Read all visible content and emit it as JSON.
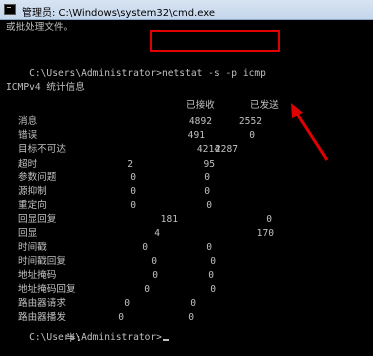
{
  "window": {
    "title": "管理员: C:\\Windows\\system32\\cmd.exe"
  },
  "console": {
    "line_top_partial": "或批处理文件。",
    "prompt_1": "C:\\Users\\Administrator>",
    "command": "netstat -s -p icmp",
    "section_title": "ICMPv4 统计信息",
    "header_received": "已接收",
    "header_sent": "已发送",
    "rows": [
      {
        "label": "消息",
        "received": "4892",
        "sent": "2552"
      },
      {
        "label": "错误",
        "received": "491",
        "sent": "0"
      },
      {
        "label": "目标不可达",
        "received": "4214",
        "sent": "2287"
      },
      {
        "label": "超时",
        "received": "2",
        "sent": "95"
      },
      {
        "label": "参数问题",
        "received": "0",
        "sent": "0"
      },
      {
        "label": "源抑制",
        "received": "0",
        "sent": "0"
      },
      {
        "label": "重定向",
        "received": "0",
        "sent": "0"
      },
      {
        "label": "回显回复",
        "received": "181",
        "sent": "0"
      },
      {
        "label": "回显",
        "received": "4",
        "sent": "170"
      },
      {
        "label": "时间戳",
        "received": "0",
        "sent": "0"
      },
      {
        "label": "时间戳回复",
        "received": "0",
        "sent": "0"
      },
      {
        "label": "地址掩码",
        "received": "0",
        "sent": "0"
      },
      {
        "label": "地址掩码回复",
        "received": "0",
        "sent": "0"
      },
      {
        "label": "路由器请求",
        "received": "0",
        "sent": "0"
      },
      {
        "label": "路由器播发",
        "received": "0",
        "sent": "0"
      }
    ],
    "prompt_2": "C:\\Users\\Administrator>",
    "footer_partial": "半:"
  },
  "annotation": {
    "highlight_color": "#e10000"
  }
}
